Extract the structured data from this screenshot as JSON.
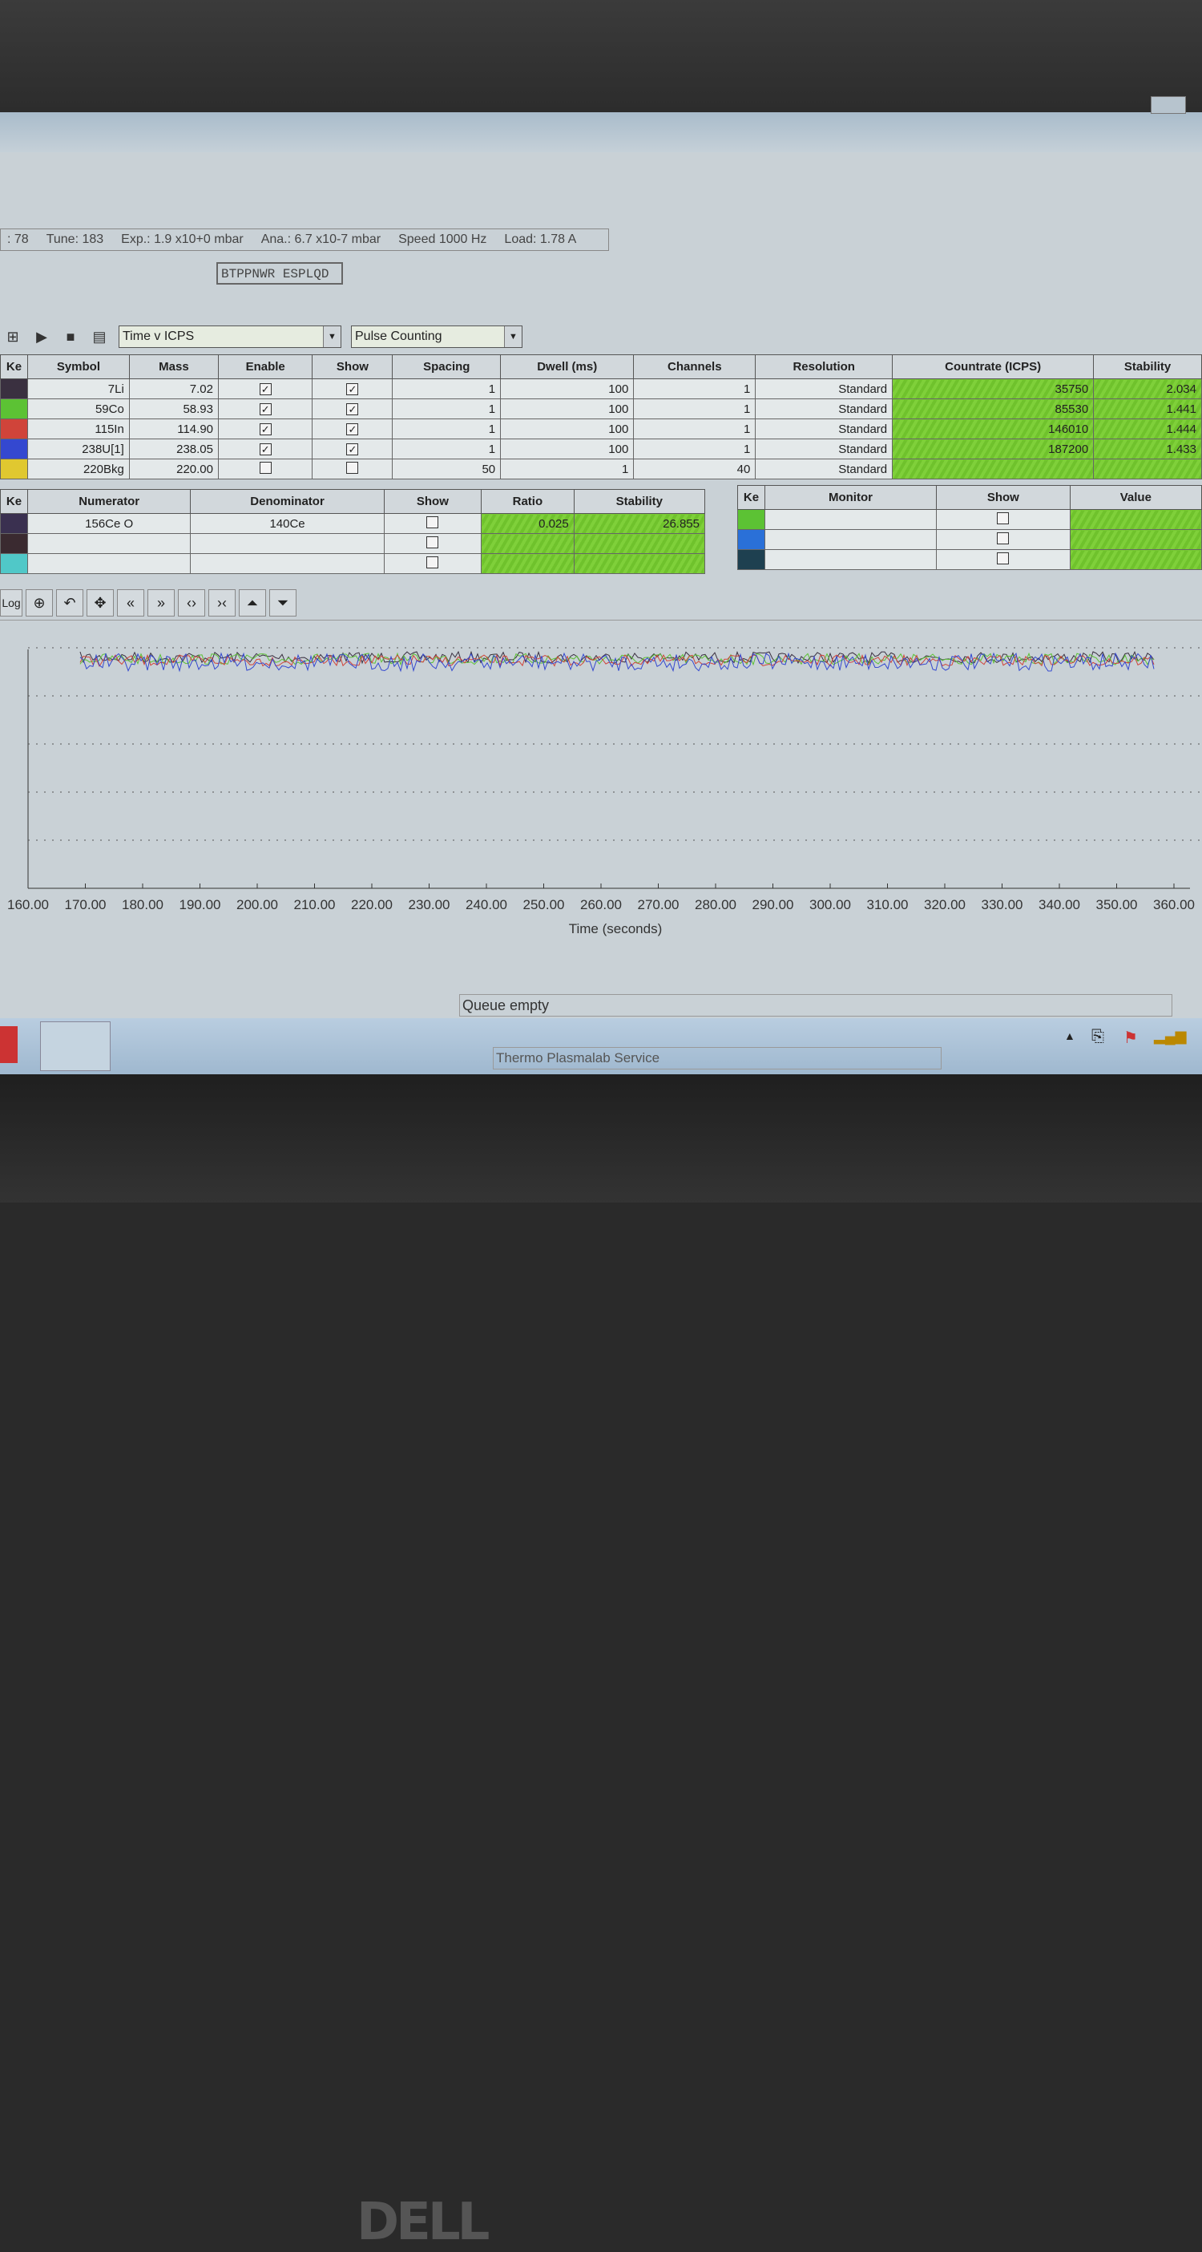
{
  "status": {
    "items": [
      ": 78",
      "Tune: 183",
      "Exp.: 1.9 x10+0 mbar",
      "Ana.: 6.7 x10-7 mbar",
      "Speed 1000 Hz",
      "Load: 1.78 A"
    ]
  },
  "code_field": "BTPPNWR ESPLQD",
  "toolbar": {
    "view_select": "Time v ICPS",
    "mode_select": "Pulse Counting"
  },
  "mass_table": {
    "headers": [
      "Ke",
      "Symbol",
      "Mass",
      "Enable",
      "Show",
      "Spacing",
      "Dwell (ms)",
      "Channels",
      "Resolution",
      "Countrate (ICPS)",
      "Stability"
    ],
    "rows": [
      {
        "color": "#3a3040",
        "symbol": "7Li",
        "mass": "7.02",
        "enable": true,
        "show": true,
        "spacing": "1",
        "dwell": "100",
        "channels": "1",
        "resolution": "Standard",
        "countrate": "35750",
        "stability": "2.034"
      },
      {
        "color": "#5cc234",
        "symbol": "59Co",
        "mass": "58.93",
        "enable": true,
        "show": true,
        "spacing": "1",
        "dwell": "100",
        "channels": "1",
        "resolution": "Standard",
        "countrate": "85530",
        "stability": "1.441"
      },
      {
        "color": "#d0443a",
        "symbol": "115In",
        "mass": "114.90",
        "enable": true,
        "show": true,
        "spacing": "1",
        "dwell": "100",
        "channels": "1",
        "resolution": "Standard",
        "countrate": "146010",
        "stability": "1.444"
      },
      {
        "color": "#3448d0",
        "symbol": "238U[1]",
        "mass": "238.05",
        "enable": true,
        "show": true,
        "spacing": "1",
        "dwell": "100",
        "channels": "1",
        "resolution": "Standard",
        "countrate": "187200",
        "stability": "1.433"
      },
      {
        "color": "#e0c830",
        "symbol": "220Bkg",
        "mass": "220.00",
        "enable": false,
        "show": false,
        "spacing": "50",
        "dwell": "1",
        "channels": "40",
        "resolution": "Standard",
        "countrate": "",
        "stability": ""
      }
    ]
  },
  "ratio_table": {
    "headers": [
      "Ke",
      "Numerator",
      "Denominator",
      "Show",
      "Ratio",
      "Stability"
    ],
    "rows": [
      {
        "color": "#3a3050",
        "numerator": "156Ce O",
        "denominator": "140Ce",
        "ratio": "0.025",
        "stability": "26.855"
      },
      {
        "color": "#3a2a30",
        "numerator": "",
        "denominator": "",
        "ratio": "",
        "stability": ""
      },
      {
        "color": "#50c8c8",
        "numerator": "",
        "denominator": "",
        "ratio": "",
        "stability": ""
      }
    ]
  },
  "monitor_table": {
    "headers": [
      "Ke",
      "Monitor",
      "Show",
      "Value"
    ],
    "rows": [
      {
        "color": "#5cc234"
      },
      {
        "color": "#2a70d8"
      },
      {
        "color": "#1e4050"
      }
    ]
  },
  "graph_toolbar": {
    "log_label": "Log"
  },
  "chart_data": {
    "type": "line",
    "xlabel": "Time (seconds)",
    "x_ticks": [
      "160.00",
      "170.00",
      "180.00",
      "190.00",
      "200.00",
      "210.00",
      "220.00",
      "230.00",
      "240.00",
      "250.00",
      "260.00",
      "270.00",
      "280.00",
      "290.00",
      "300.00",
      "310.00",
      "320.00",
      "330.00",
      "340.00",
      "350.00",
      "360.00"
    ],
    "xlim": [
      160,
      360
    ],
    "grid": "horizontal dotted",
    "series_colors": [
      "#3a3040",
      "#5cc234",
      "#d0443a",
      "#3448d0"
    ]
  },
  "queue_status": "Queue empty",
  "taskbar": {
    "task": "Thermo Plasmalab Service"
  },
  "brand": "DELL"
}
